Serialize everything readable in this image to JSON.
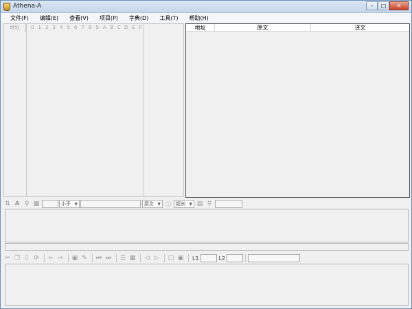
{
  "window": {
    "title": "Athena-A"
  },
  "menu": [
    {
      "label": "文件(F)"
    },
    {
      "label": "编辑(E)"
    },
    {
      "label": "查看(V)"
    },
    {
      "label": "项目(P)"
    },
    {
      "label": "字典(D)"
    },
    {
      "label": "工具(T)"
    },
    {
      "label": "帮助(H)"
    }
  ],
  "hex_view": {
    "address_header": "地址",
    "columns": [
      "0",
      "1",
      "2",
      "3",
      "4",
      "5",
      "6",
      "7",
      "8",
      "9",
      "A",
      "B",
      "C",
      "D",
      "E",
      "F"
    ]
  },
  "table": {
    "headers": {
      "address": "地址",
      "original": "原文",
      "translation": "译文"
    }
  },
  "toolbar1": {
    "compare_select": "小于",
    "text_select": "原文",
    "length_select": "超长"
  },
  "toolbar2": {
    "l1_label": "L1",
    "l2_label": "L2"
  }
}
